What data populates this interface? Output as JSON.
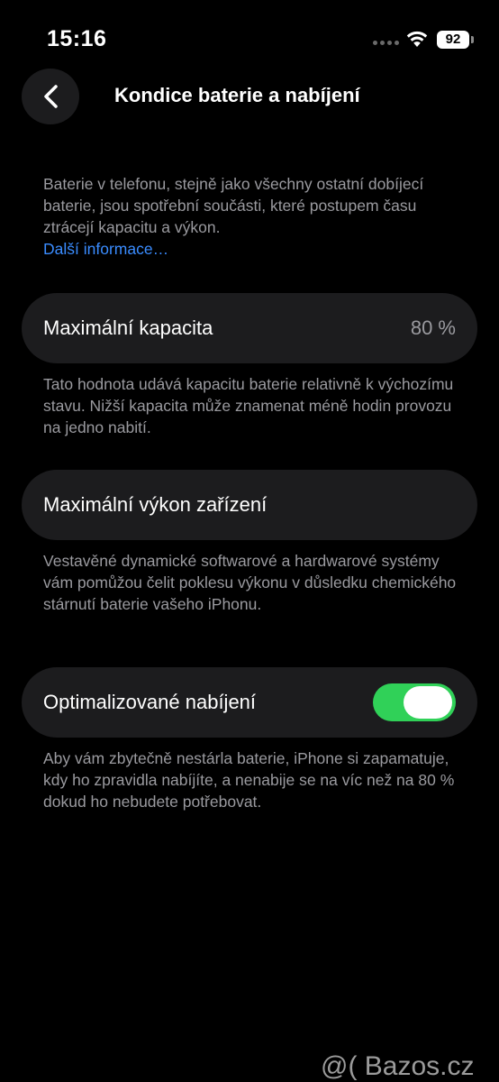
{
  "status_bar": {
    "time": "15:16",
    "battery_level": "92",
    "icons": [
      "signal-dots-icon",
      "wifi-icon",
      "battery-icon"
    ]
  },
  "nav": {
    "back_icon": "chevron-left-icon",
    "title": "Kondice baterie a nabíjení"
  },
  "intro": {
    "text": "Baterie v telefonu, stejně jako všechny ostatní dobíjecí baterie, jsou spotřební součásti, které postupem času ztrácejí kapacitu a výkon.",
    "link": "Další informace…"
  },
  "max_capacity": {
    "label": "Maximální kapacita",
    "value": "80 %",
    "footnote": "Tato hodnota udává kapacitu baterie relativně k výchozímu stavu. Nižší kapacita může znamenat méně hodin provozu na jedno nabití."
  },
  "peak_performance": {
    "label": "Maximální výkon zařízení",
    "footnote": "Vestavěné dynamické softwarové a hardwarové systémy vám pomůžou čelit poklesu výkonu v důsledku chemického stárnutí baterie vašeho iPhonu."
  },
  "optimized_charging": {
    "label": "Optimalizované nabíjení",
    "enabled": true,
    "footnote": "Aby vám zbytečně nestárla baterie, iPhone si zapamatuje, kdy ho zpravidla nabíjíte, a nenabije se na víc než na 80 % dokud ho nebudete potřebovat."
  },
  "colors": {
    "background": "#000000",
    "card": "#1c1c1e",
    "secondary_text": "#9a9a9f",
    "link": "#3a8cff",
    "toggle_on": "#30d158"
  },
  "watermark": "@( Bazos.cz"
}
